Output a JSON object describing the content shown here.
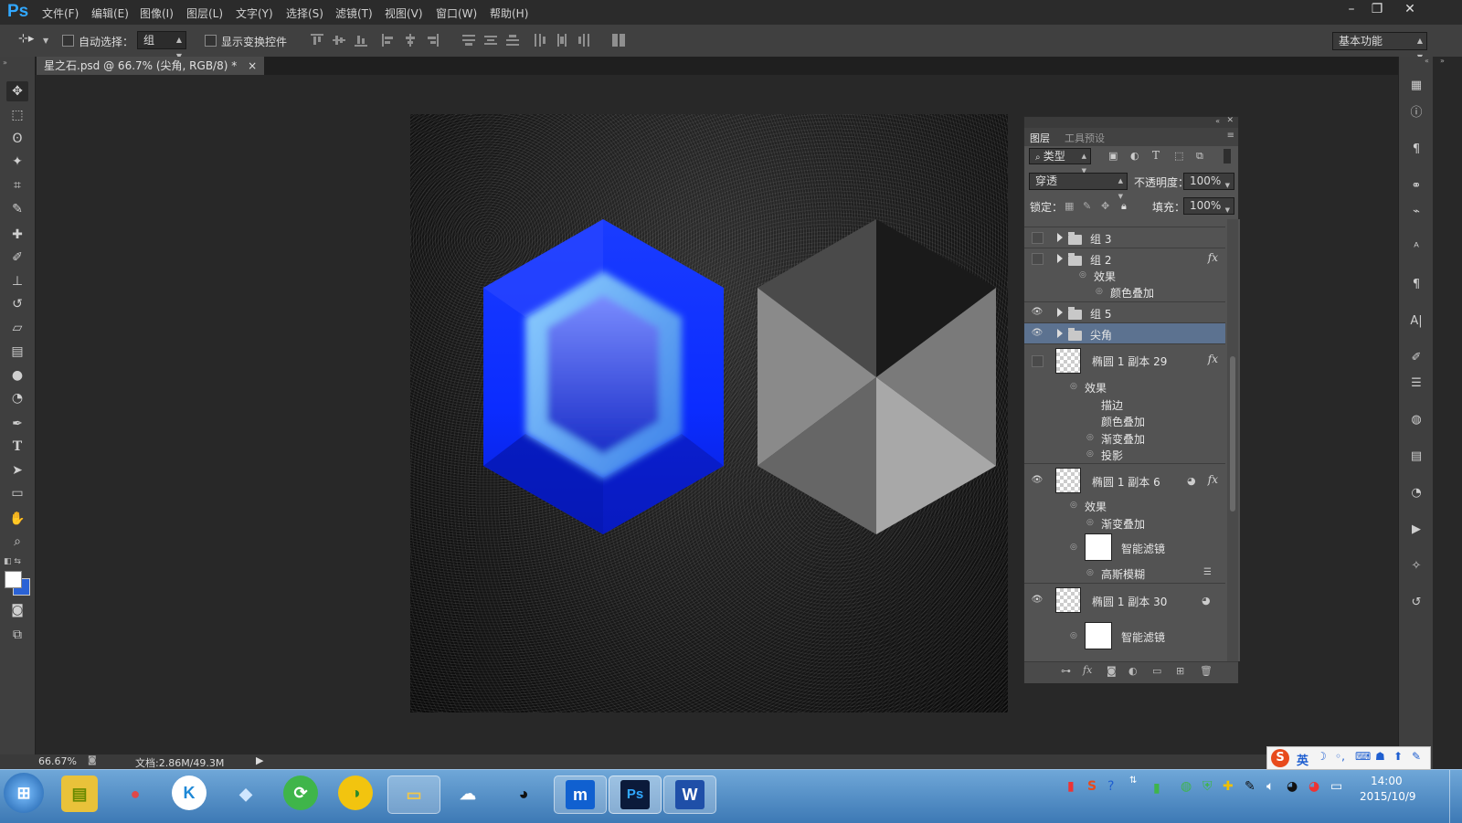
{
  "app": {
    "logo": "Ps"
  },
  "menu": [
    "文件(F)",
    "编辑(E)",
    "图像(I)",
    "图层(L)",
    "文字(Y)",
    "选择(S)",
    "滤镜(T)",
    "视图(V)",
    "窗口(W)",
    "帮助(H)"
  ],
  "window_controls": {
    "minimize": "–",
    "restore": "❐",
    "close": "✕"
  },
  "options": {
    "auto_select_label": "自动选择：",
    "auto_select_value": "组",
    "show_transform_label": "显示变换控件",
    "workspace": "基本功能"
  },
  "document": {
    "tab_label": "星之石.psd @ 66.7% (尖角, RGB/8) *",
    "tab_close": "×"
  },
  "layers_panel": {
    "tabs": [
      "图层",
      "工具预设"
    ],
    "filter_kind": "类型",
    "blend_mode": "穿透",
    "opacity_label": "不透明度：",
    "opacity_value": "100%",
    "lock_label": "锁定：",
    "fill_label": "填充：",
    "fill_value": "100%",
    "rows": {
      "group3": "组 3",
      "group2": "组 2",
      "group2_effects": "效果",
      "group2_color_overlay": "颜色叠加",
      "group5": "组 5",
      "spike": "尖角",
      "ellipse29": "椭圆 1 副本 29",
      "e29_effects": "效果",
      "e29_stroke": "描边",
      "e29_color_overlay": "颜色叠加",
      "e29_gradient_overlay": "渐变叠加",
      "e29_drop_shadow": "投影",
      "ellipse6": "椭圆 1 副本 6",
      "e6_effects": "效果",
      "e6_gradient_overlay": "渐变叠加",
      "e6_smart_filters": "智能滤镜",
      "e6_gaussian_blur": "高斯模糊",
      "ellipse30": "椭圆 1 副本 30",
      "e30_smart_filters": "智能滤镜"
    },
    "fx_label": "fx"
  },
  "status": {
    "zoom": "66.67%",
    "doc_size": "文档:2.86M/49.3M"
  },
  "taskbar": {
    "clock_time": "14:00",
    "clock_date": "2015/10/9",
    "ime_lang": "英",
    "ps_label": "Ps",
    "word_label": "W"
  }
}
